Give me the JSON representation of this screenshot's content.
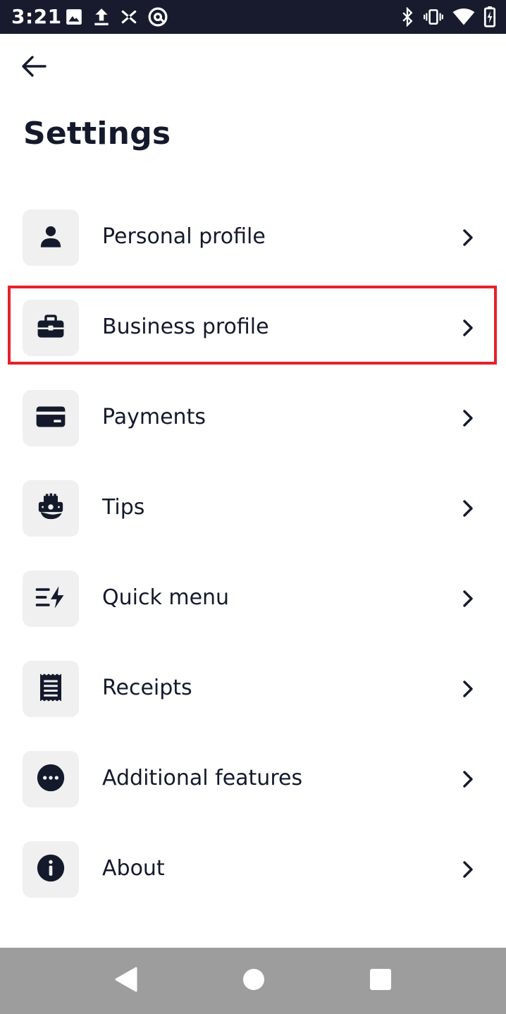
{
  "status_bar": {
    "time": "3:21",
    "left_icons": [
      "image-icon",
      "upload-icon",
      "scissors-icon",
      "at-sign-icon"
    ],
    "right_icons": [
      "bluetooth-icon",
      "vibrate-icon",
      "wifi-icon",
      "battery-charging-icon"
    ]
  },
  "header": {
    "title": "Settings",
    "back_icon": "arrow-left-icon"
  },
  "menu": {
    "items": [
      {
        "label": "Personal profile",
        "icon": "person-icon"
      },
      {
        "label": "Business profile",
        "icon": "briefcase-icon"
      },
      {
        "label": "Payments",
        "icon": "credit-card-icon"
      },
      {
        "label": "Tips",
        "icon": "tip-hand-icon"
      },
      {
        "label": "Quick menu",
        "icon": "quick-menu-bolt-icon"
      },
      {
        "label": "Receipts",
        "icon": "receipt-icon"
      },
      {
        "label": "Additional features",
        "icon": "more-dots-icon"
      },
      {
        "label": "About",
        "icon": "info-icon"
      }
    ],
    "highlighted_index": 1
  },
  "colors": {
    "status_bar": "#171b2d",
    "text": "#141a2c",
    "tile": "#f0f0f0",
    "highlight": "#e8202a",
    "nav_bar": "#9d9d9d"
  },
  "nav_bar": {
    "buttons": [
      "nav-back-icon",
      "nav-home-icon",
      "nav-recents-icon"
    ]
  }
}
